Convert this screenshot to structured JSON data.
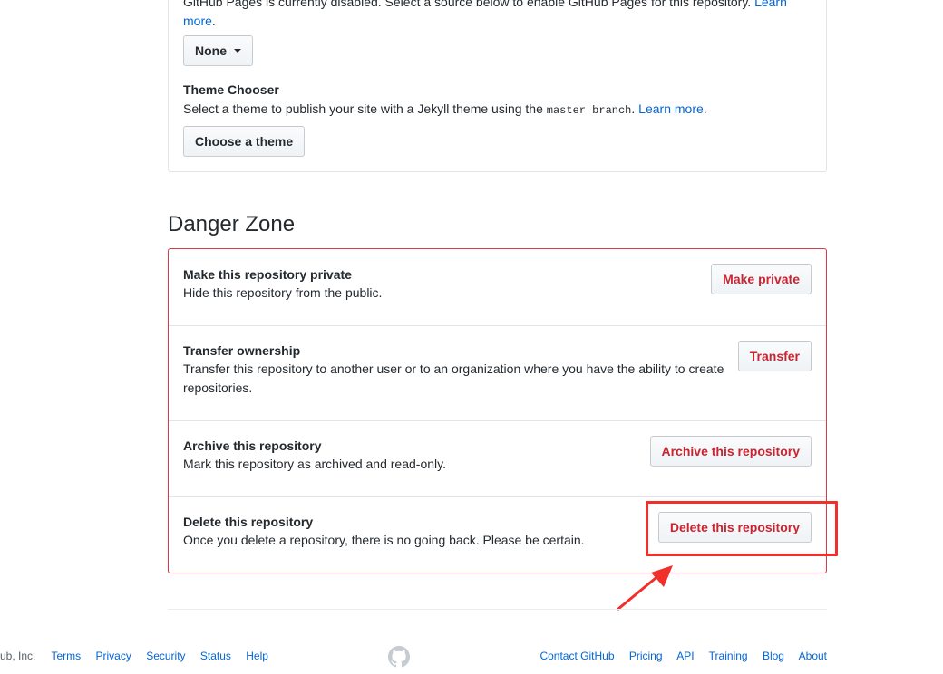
{
  "pages": {
    "intro_text": "GitHub Pages is currently disabled. Select a source below to enable GitHub Pages for this repository.",
    "intro_link": "Learn more",
    "source_select": "None",
    "theme_title": "Theme Chooser",
    "theme_desc_before": "Select a theme to publish your site with a Jekyll theme using the ",
    "theme_code": "master branch",
    "theme_link": "Learn more",
    "theme_button": "Choose a theme"
  },
  "danger_zone": {
    "heading": "Danger Zone",
    "items": [
      {
        "title": "Make this repository private",
        "desc": "Hide this repository from the public.",
        "button": "Make private"
      },
      {
        "title": "Transfer ownership",
        "desc": "Transfer this repository to another user or to an organization where you have the ability to create repositories.",
        "button": "Transfer"
      },
      {
        "title": "Archive this repository",
        "desc": "Mark this repository as archived and read-only.",
        "button": "Archive this repository"
      },
      {
        "title": "Delete this repository",
        "desc": "Once you delete a repository, there is no going back. Please be certain.",
        "button": "Delete this repository"
      }
    ]
  },
  "annotation": {
    "highlight_color": "#f0302a",
    "icon": "red-arrow-icon"
  },
  "footer": {
    "copyright": "ub, Inc.",
    "left_links": [
      "Terms",
      "Privacy",
      "Security",
      "Status",
      "Help"
    ],
    "logo_icon": "octocat-icon",
    "right_links": [
      "Contact GitHub",
      "Pricing",
      "API",
      "Training",
      "Blog",
      "About"
    ]
  },
  "colors": {
    "link": "#0366d6",
    "danger": "#cb2431",
    "danger_border": "#d73a49"
  }
}
